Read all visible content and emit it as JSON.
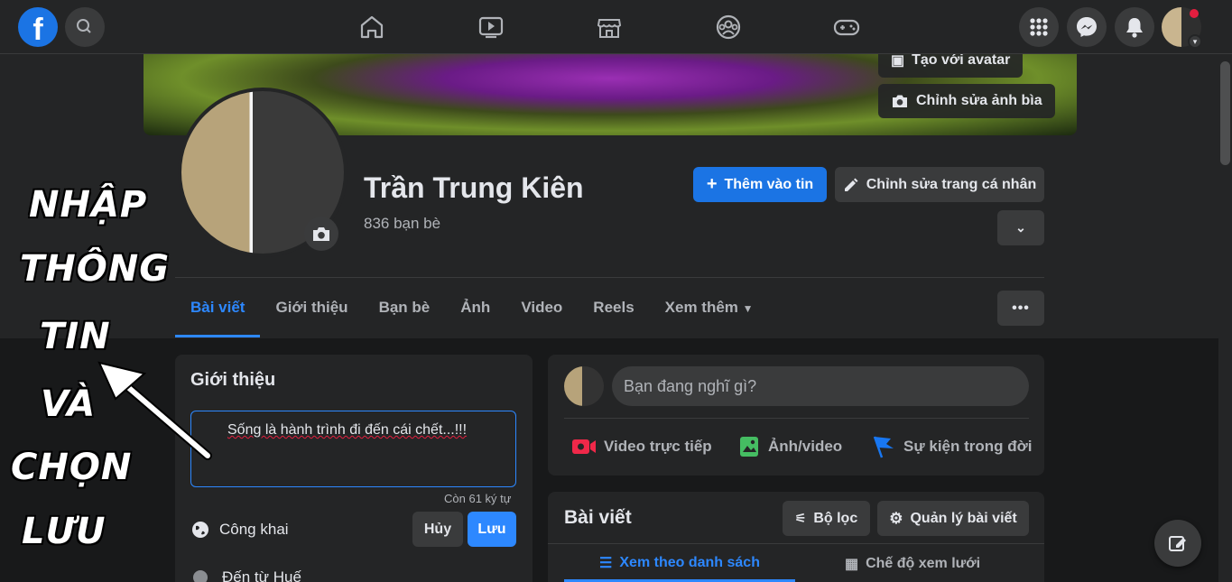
{
  "nav": {
    "logo_letter": "f",
    "icons": [
      "home-icon",
      "watch-icon",
      "marketplace-icon",
      "groups-icon",
      "gaming-icon"
    ],
    "right_icons": [
      "menu-grid-icon",
      "messenger-icon",
      "notifications-icon"
    ]
  },
  "cover": {
    "create_avatar_label": "Tạo với avatar",
    "edit_cover_label": "Chỉnh sửa ảnh bìa"
  },
  "profile": {
    "name": "Trần Trung Kiên",
    "friends": "836 bạn bè",
    "add_story_label": "Thêm vào tin",
    "edit_profile_label": "Chỉnh sửa trang cá nhân"
  },
  "tabs": [
    "Bài viết",
    "Giới thiệu",
    "Bạn bè",
    "Ảnh",
    "Video",
    "Reels",
    "Xem thêm"
  ],
  "intro": {
    "title": "Giới thiệu",
    "bio_value": "Sống là hành trình đi đến cái chết...!!!",
    "char_count": "Còn 61 ký tự",
    "privacy": "Công khai",
    "cancel_label": "Hủy",
    "save_label": "Lưu",
    "from_label": "Đến từ Huế"
  },
  "composer": {
    "placeholder": "Bạn đang nghĩ gì?",
    "live_label": "Video trực tiếp",
    "photo_label": "Ảnh/video",
    "life_event_label": "Sự kiện trong đời"
  },
  "posts": {
    "title": "Bài viết",
    "filter_label": "Bộ lọc",
    "manage_label": "Quản lý bài viết",
    "list_view_label": "Xem theo danh sách",
    "grid_view_label": "Chế độ xem lưới"
  },
  "annotation": {
    "line1": "NHẬP",
    "line2": "THÔNG",
    "line3": "TIN",
    "line4": "VÀ",
    "line5": "CHỌN",
    "line6": "LƯU"
  },
  "colors": {
    "accent": "#2d88ff",
    "primary_button": "#1b74e4",
    "background": "#18191a",
    "card": "#242526",
    "live_red": "#f02849",
    "photo_green": "#45bd62",
    "event_blue": "#1877f2"
  }
}
